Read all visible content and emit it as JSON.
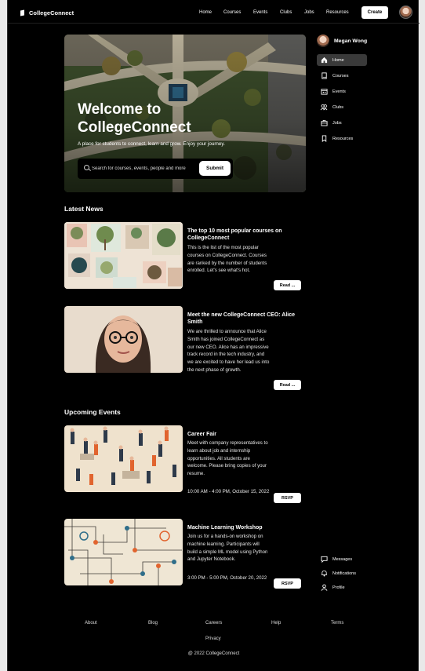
{
  "brand": {
    "name": "CollegeConnect"
  },
  "nav": {
    "links": [
      "Home",
      "Courses",
      "Events",
      "Clubs",
      "Jobs",
      "Resources"
    ],
    "create_label": "Create"
  },
  "hero": {
    "title_line1": "Welcome to",
    "title_line2": "CollegeConnect",
    "subtitle": "A place for students to connect, learn and grow. Enjoy your journey.",
    "search_placeholder": "Search for courses, events, people and more",
    "submit_label": "Submit"
  },
  "news": {
    "heading": "Latest News",
    "items": [
      {
        "title": "The top 10 most popular courses on CollegeConnect",
        "body": "This is the list of the most popular courses on CollegeConnect. Courses are ranked by the number of students enrolled. Let's see what's hot.",
        "button": "Read ..."
      },
      {
        "title": "Meet the new CollegeConnect CEO: Alice Smith",
        "body": "We are thrilled to announce that Alice Smith has joined CollegeConnect as our new CEO. Alice has an impressive track record in the tech industry, and we are excited to have her lead us into the next phase of growth.",
        "button": "Read ..."
      }
    ]
  },
  "events": {
    "heading": "Upcoming Events",
    "items": [
      {
        "title": "Career Fair",
        "body": "Meet with company representatives to learn about job and internship opportunities. All students are welcome. Please bring copies of your resume.",
        "time": "10:00 AM - 4:00 PM, October 15, 2022",
        "button": "RSVP"
      },
      {
        "title": "Machine Learning Workshop",
        "body": "Join us for a hands-on workshop on machine learning. Participants will build a simple ML model using Python and Jupyter Notebook.",
        "time": "3:00 PM - 5:00 PM, October 20, 2022",
        "button": "RSVP"
      }
    ]
  },
  "sidebar": {
    "user_name": "Megan Wong",
    "items": [
      {
        "label": "Home",
        "icon": "home-icon"
      },
      {
        "label": "Courses",
        "icon": "book-icon"
      },
      {
        "label": "Events",
        "icon": "calendar-icon"
      },
      {
        "label": "Clubs",
        "icon": "people-icon"
      },
      {
        "label": "Jobs",
        "icon": "briefcase-icon"
      },
      {
        "label": "Resources",
        "icon": "bookmark-icon"
      }
    ],
    "bottom_items": [
      {
        "label": "Messages",
        "icon": "chat-icon"
      },
      {
        "label": "Notifications",
        "icon": "bell-icon"
      },
      {
        "label": "Profile",
        "icon": "user-icon"
      }
    ]
  },
  "footer": {
    "links": [
      "About",
      "Blog",
      "Careers",
      "Help",
      "Terms",
      "Privacy"
    ],
    "copyright": "@ 2022 CollegeConnect"
  }
}
